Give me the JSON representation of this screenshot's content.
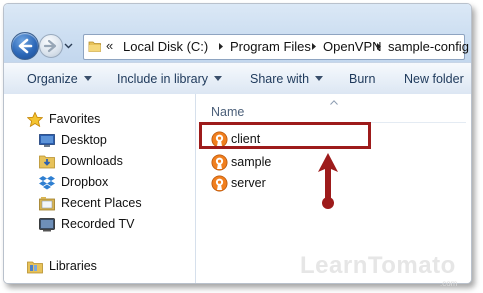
{
  "address_bar": {
    "overflow_glyph": "«",
    "breadcrumbs": [
      "Local Disk (C:)",
      "Program Files",
      "OpenVPN",
      "sample-config"
    ]
  },
  "toolbar": {
    "organize": "Organize",
    "include_in_library": "Include in library",
    "share_with": "Share with",
    "burn": "Burn",
    "new_folder": "New folder"
  },
  "nav_pane": {
    "favorites": {
      "label": "Favorites",
      "icon": "star-icon",
      "items": [
        {
          "label": "Desktop",
          "icon": "desktop-icon"
        },
        {
          "label": "Downloads",
          "icon": "downloads-folder-icon"
        },
        {
          "label": "Dropbox",
          "icon": "dropbox-icon"
        },
        {
          "label": "Recent Places",
          "icon": "recent-places-icon"
        },
        {
          "label": "Recorded TV",
          "icon": "recorded-tv-icon"
        }
      ]
    },
    "libraries": {
      "label": "Libraries",
      "icon": "libraries-icon"
    }
  },
  "content": {
    "column_header": "Name",
    "files": [
      {
        "name": "client",
        "icon": "openvpn-config-icon",
        "highlighted": true
      },
      {
        "name": "sample",
        "icon": "openvpn-config-icon",
        "highlighted": false
      },
      {
        "name": "server",
        "icon": "openvpn-config-icon",
        "highlighted": false
      }
    ]
  },
  "annotation": {
    "color": "#9d1b1b"
  },
  "watermark": {
    "text": "LearnTomato",
    "sub": ".com"
  }
}
